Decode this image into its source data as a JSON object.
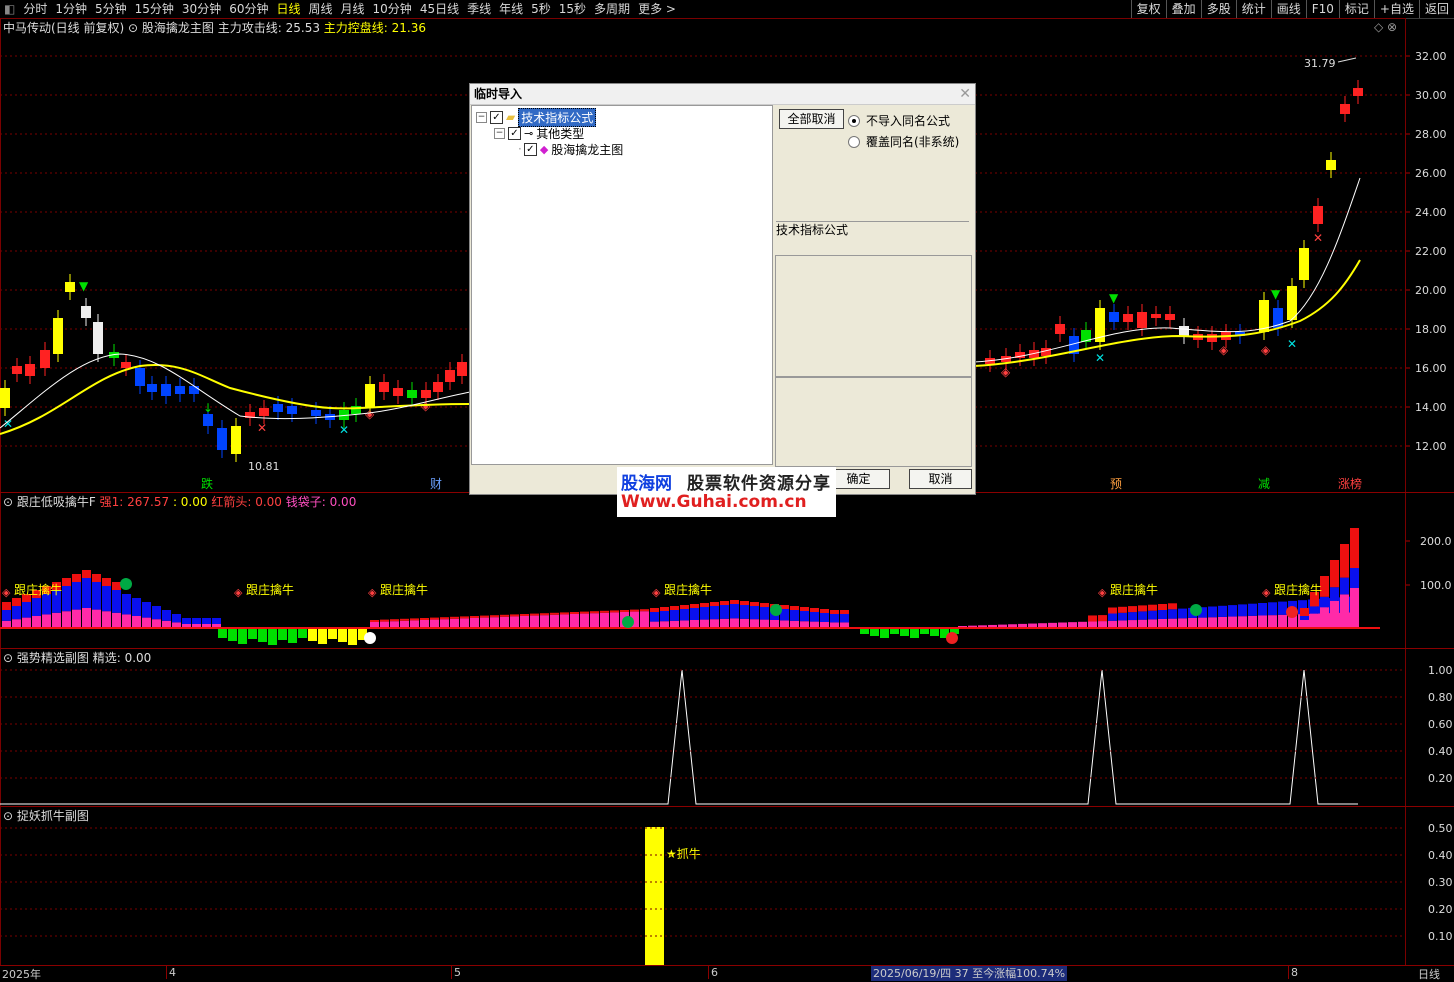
{
  "toolbar": {
    "periods": [
      "分时",
      "1分钟",
      "5分钟",
      "15分钟",
      "30分钟",
      "60分钟",
      "日线",
      "周线",
      "月线",
      "10分钟",
      "45日线",
      "季线",
      "年线",
      "5秒",
      "15秒",
      "多周期",
      "更多 >"
    ],
    "active": "日线",
    "right": [
      "复权",
      "叠加",
      "多股",
      "统计",
      "画线",
      "F10",
      "标记",
      "+自选",
      "返回"
    ]
  },
  "main": {
    "stock": "中马传动(日线 前复权)",
    "indicator": "股海擒龙主图",
    "line1": "主力攻击线: 25.53",
    "line2": "主力控盘线: 21.36",
    "high_label": "31.79",
    "low_label": "10.81",
    "yticks": [
      "32.00",
      "30.00",
      "28.00",
      "26.00",
      "24.00",
      "22.00",
      "20.00",
      "18.00",
      "16.00",
      "14.00",
      "12.00"
    ],
    "markers": [
      "跌",
      "财",
      "预",
      "减",
      "涨榜"
    ]
  },
  "panel2": {
    "name": "跟庄低吸擒牛F",
    "v1": "强1: 267.57",
    "v2": ": 0.00",
    "v3": "红箭头: 0.00",
    "v4": "钱袋子: 0.00",
    "label": "跟庄擒牛",
    "yticks": [
      "200.0",
      "100.0"
    ]
  },
  "panel3": {
    "name": "强势精选副图",
    "v1": "精选: 0.00",
    "yticks": [
      "1.00",
      "0.80",
      "0.60",
      "0.40",
      "0.20"
    ]
  },
  "panel4": {
    "name": "捉妖抓牛副图",
    "label": "★抓牛",
    "yticks": [
      "0.50",
      "0.40",
      "0.30",
      "0.20",
      "0.10"
    ]
  },
  "xaxis": {
    "labels": [
      "2025年",
      "4",
      "5",
      "6",
      "8"
    ],
    "status": "2025/06/19/四 37 至今涨幅100.74%",
    "period": "日线"
  },
  "dialog": {
    "title": "临时导入",
    "tree_root": "技术指标公式",
    "tree_child": "其他类型",
    "tree_leaf": "股海擒龙主图",
    "btn_cancel_all": "全部取消",
    "radio1": "不导入同名公式",
    "radio2": "覆盖同名(非系统)",
    "group_label": "技术指标公式",
    "ok": "确定",
    "cancel": "取消"
  },
  "watermark": {
    "line1a": "股海网",
    "line1b": "股票软件资源分享",
    "line2": "Www.Guhai.com.cn"
  },
  "colors": {
    "up": "#ff2020",
    "down": "#0040ff",
    "yellow": "#ffff00",
    "grid": "#8a0000",
    "magenta": "#ff2aa8",
    "green": "#00e000"
  }
}
